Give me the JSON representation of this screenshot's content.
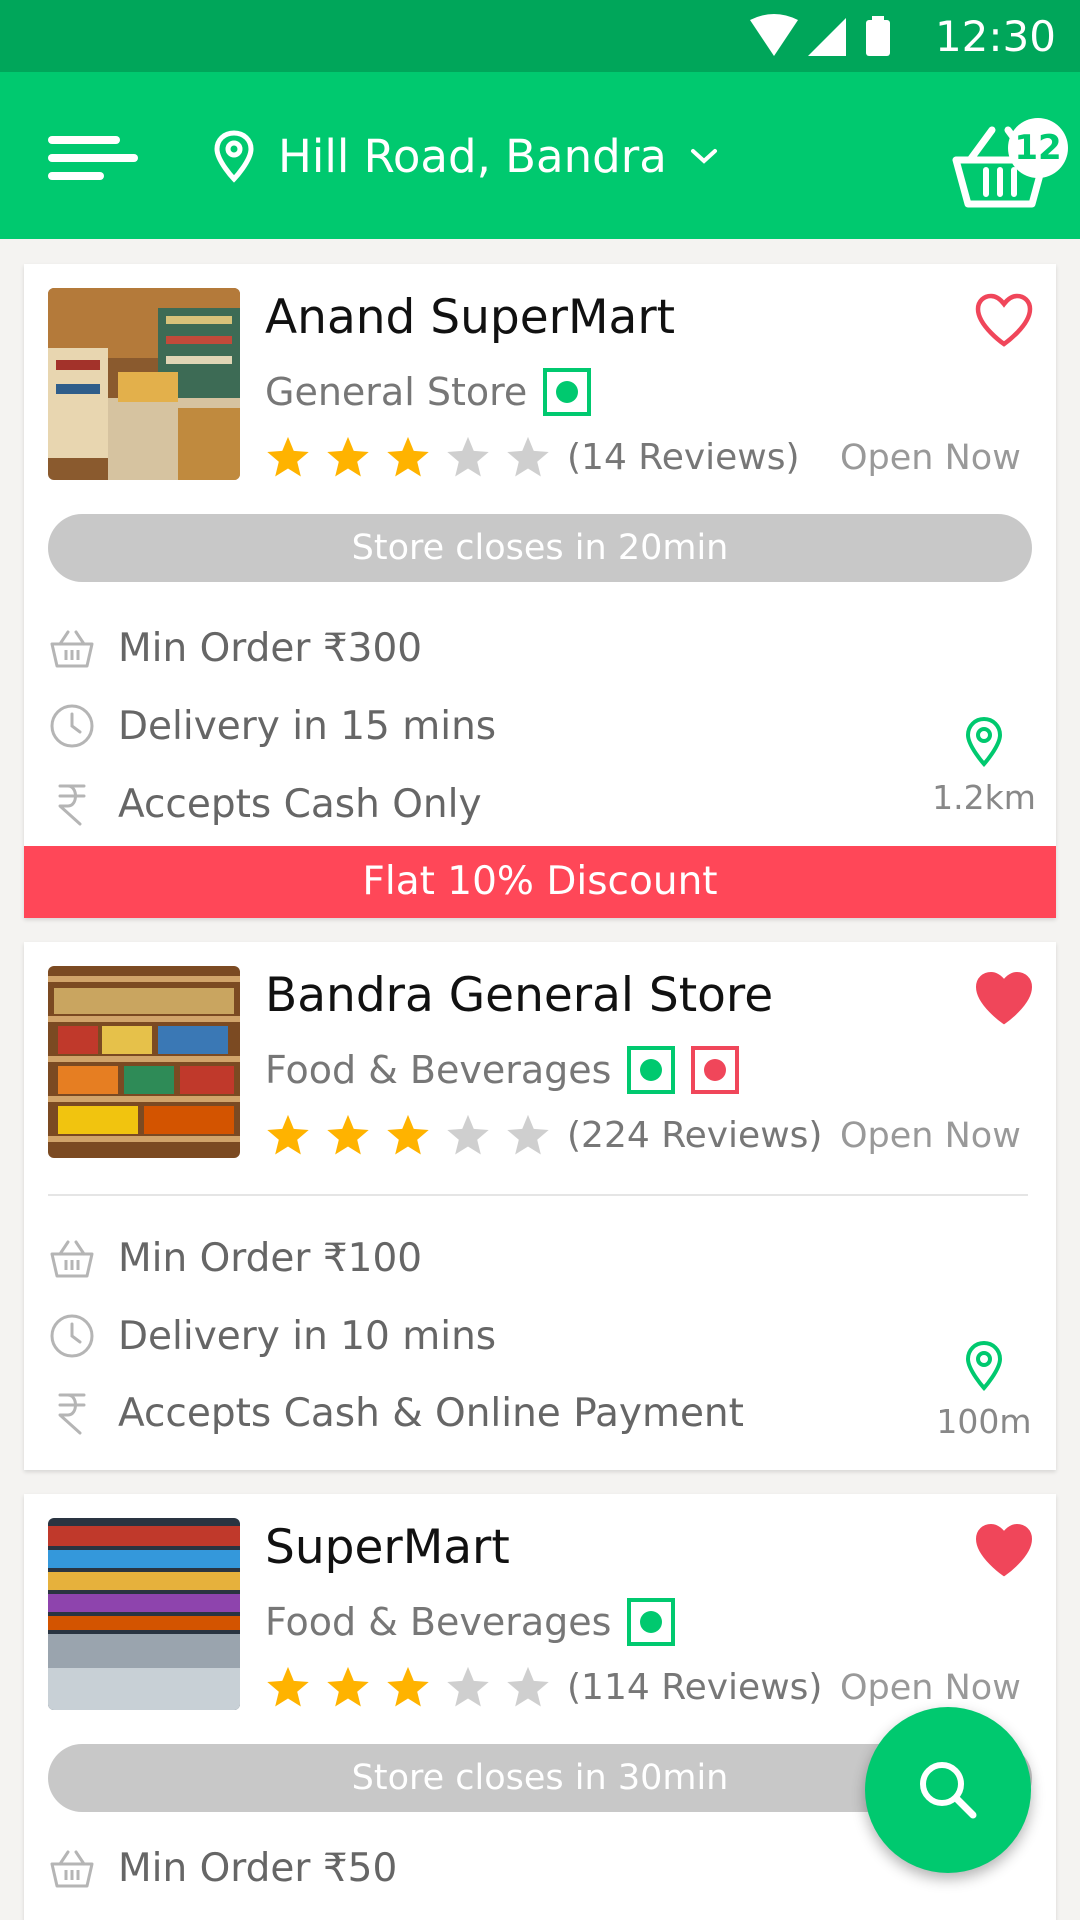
{
  "status_bar": {
    "time": "12:30"
  },
  "header": {
    "location": "Hill Road, Bandra",
    "cart_count": "12"
  },
  "colors": {
    "brand": "#00c96f",
    "status_bar": "#00a65a",
    "discount": "#ff4758",
    "star": "#ffb300"
  },
  "stores": [
    {
      "name": "Anand SuperMart",
      "category": "General Store",
      "badges": [
        "veg"
      ],
      "rating": 3,
      "reviews": "(14 Reviews)",
      "status": "Open Now",
      "closing": "Store closes in 20min",
      "min_order": "Min Order ₹300",
      "delivery": "Delivery in 15 mins",
      "payment": "Accepts Cash Only",
      "distance": "1.2km",
      "discount": "Flat 10% Discount",
      "favorite": false
    },
    {
      "name": "Bandra General Store",
      "category": "Food & Beverages",
      "badges": [
        "veg",
        "non-veg"
      ],
      "rating": 3,
      "reviews": "(224 Reviews)",
      "status": "Open Now",
      "min_order": "Min Order ₹100",
      "delivery": "Delivery in 10 mins",
      "payment": "Accepts Cash & Online Payment",
      "distance": "100m",
      "favorite": true
    },
    {
      "name": "SuperMart",
      "category": "Food & Beverages",
      "badges": [
        "veg"
      ],
      "rating": 3,
      "reviews": "(114 Reviews)",
      "status": "Open Now",
      "closing": "Store closes in 30min",
      "min_order": "Min Order ₹50",
      "favorite": true
    }
  ],
  "icons": {
    "menu": "hamburger-menu-icon",
    "location": "map-pin-icon",
    "cart": "basket-icon",
    "favorite": "heart-icon",
    "min_order": "basket-icon",
    "delivery": "clock-icon",
    "payment": "rupee-icon",
    "fab": "search-icon"
  }
}
